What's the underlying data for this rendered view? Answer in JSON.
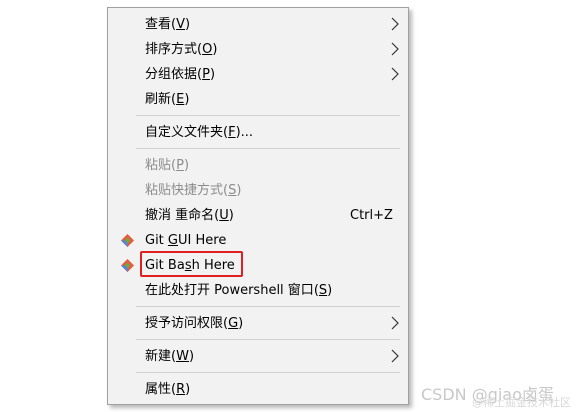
{
  "menu": {
    "items": [
      {
        "label": "查看",
        "mnemonic": "V"
      },
      {
        "label": "排序方式",
        "mnemonic": "O"
      },
      {
        "label": "分组依据",
        "mnemonic": "P"
      },
      {
        "label": "刷新",
        "mnemonic": "E"
      },
      {
        "label": "自定义文件夹",
        "mnemonic": "F",
        "suffix": "..."
      },
      {
        "label": "粘贴",
        "mnemonic": "P"
      },
      {
        "label": "粘贴快捷方式",
        "mnemonic": "S"
      },
      {
        "label": "撤消 重命名",
        "mnemonic": "U",
        "shortcut": "Ctrl+Z"
      },
      {
        "label_pre": "Git ",
        "label_mn": "G",
        "label_post": "UI Here",
        "icon": "git-gui-icon"
      },
      {
        "label_pre": "Git Ba",
        "label_mn": "s",
        "label_post": "h Here",
        "icon": "git-bash-icon"
      },
      {
        "label": "在此处打开 Powershell 窗口",
        "mnemonic": "S"
      },
      {
        "label": "授予访问权限",
        "mnemonic": "G"
      },
      {
        "label": "新建",
        "mnemonic": "W"
      },
      {
        "label": "属性",
        "mnemonic": "R"
      }
    ]
  },
  "watermark": {
    "text": "CSDN @giao卤蛋",
    "subtext": "@稀土掘金技术社区"
  },
  "colors": {
    "menu_bg": "#f2f2f2",
    "disabled_text": "#8c8c8c",
    "highlight_border": "#e02020"
  }
}
